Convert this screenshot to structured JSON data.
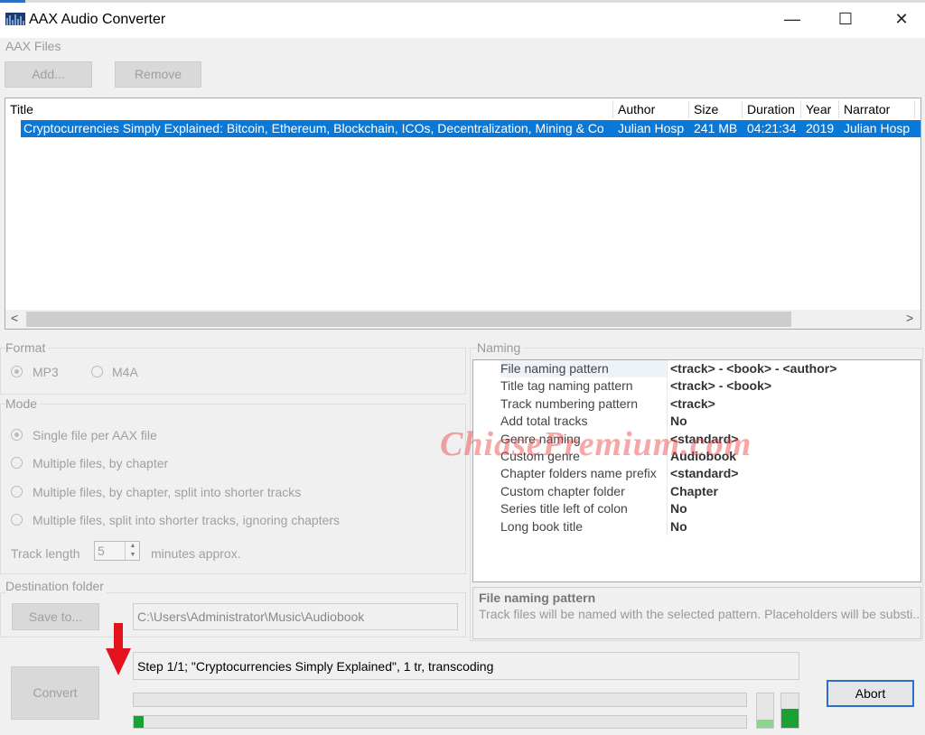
{
  "window": {
    "title": "AAX Audio Converter",
    "minimize": "—",
    "maximize": "☐",
    "close": "✕"
  },
  "aax_files": {
    "label": "AAX Files",
    "add": "Add...",
    "remove": "Remove",
    "columns": [
      "Title",
      "Author",
      "Size",
      "Duration",
      "Year",
      "Narrator"
    ],
    "rows": [
      {
        "title": "Cryptocurrencies Simply Explained: Bitcoin, Ethereum, Blockchain, ICOs, Decentralization, Mining & Co",
        "author": "Julian Hosp",
        "size": "241 MB",
        "duration": "04:21:34",
        "year": "2019",
        "narrator": "Julian Hosp",
        "selected": true
      }
    ],
    "scroll_left": "<",
    "scroll_right": ">"
  },
  "format": {
    "label": "Format",
    "options": [
      "MP3",
      "M4A"
    ],
    "selected": "MP3"
  },
  "mode": {
    "label": "Mode",
    "options": [
      "Single file per AAX file",
      "Multiple files, by chapter",
      "Multiple files, by chapter, split into shorter tracks",
      "Multiple files, split into shorter tracks, ignoring chapters"
    ],
    "selected": 0,
    "track_length_label": "Track length",
    "track_length_value": "5",
    "track_length_unit": "minutes approx."
  },
  "destination": {
    "label": "Destination folder",
    "save_to": "Save to...",
    "path": "C:\\Users\\Administrator\\Music\\Audiobook"
  },
  "naming": {
    "label": "Naming",
    "items": [
      {
        "key": "File naming pattern",
        "value": "<track> - <book> - <author>"
      },
      {
        "key": "Title tag naming pattern",
        "value": "<track> - <book>"
      },
      {
        "key": "Track numbering pattern",
        "value": "<track>"
      },
      {
        "key": "Add total tracks",
        "value": "No"
      },
      {
        "key": "Genre naming",
        "value": "<standard>"
      },
      {
        "key": "Custom genre",
        "value": "Audiobook"
      },
      {
        "key": "Chapter folders name prefix",
        "value": "<standard>"
      },
      {
        "key": "Custom chapter folder",
        "value": "Chapter"
      },
      {
        "key": "Series title left of colon",
        "value": "No"
      },
      {
        "key": "Long book title",
        "value": "No"
      }
    ],
    "desc_title": "File naming pattern",
    "desc_text": "Track files will be named with the selected pattern. Placeholders will be substi..."
  },
  "progress": {
    "convert": "Convert",
    "status": "Step 1/1; \"Cryptocurrencies Simply Explained\", 1 tr, transcoding",
    "bar1": 0,
    "bar2": 0.015,
    "meter1": 0.25,
    "meter2": 0.55,
    "abort": "Abort",
    "accent": "#1aa035"
  },
  "watermark": "ChiasePremium.com"
}
